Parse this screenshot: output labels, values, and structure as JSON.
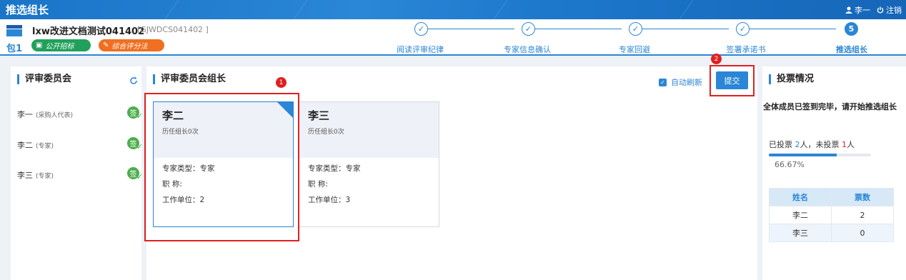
{
  "app": {
    "title": "推选组长"
  },
  "user": {
    "name": "李一",
    "logout_label": "注销"
  },
  "project": {
    "name": "lxw改进文档测试041402",
    "code": "[GJWDCS041402 ]",
    "package": "包1",
    "tags": [
      "公开招标",
      "综合评分法"
    ]
  },
  "steps": [
    {
      "label": "阅读评审纪律",
      "icon": "check",
      "number": ""
    },
    {
      "label": "专家信息确认",
      "icon": "check",
      "number": ""
    },
    {
      "label": "专家回避",
      "icon": "check",
      "number": ""
    },
    {
      "label": "签署承诺书",
      "icon": "check",
      "number": ""
    },
    {
      "label": "推选组长",
      "icon": "",
      "number": "5"
    }
  ],
  "committee": {
    "title": "评审委员会",
    "members": [
      {
        "name": "李一",
        "role": "(采购人代表)",
        "signed": "签"
      },
      {
        "name": "李二",
        "role": "(专家)",
        "signed": "签"
      },
      {
        "name": "李三",
        "role": "(专家)",
        "signed": "签"
      }
    ]
  },
  "leader": {
    "title": "评审委员会组长",
    "auto_refresh_label": "自动刷新",
    "submit_label": "提交",
    "candidates": [
      {
        "name": "李二",
        "history": "历任组长0次",
        "type_label": "专家类型：",
        "type": "专家",
        "title_label": "职 称:",
        "title": "",
        "unit_label": "工作单位：",
        "unit": "2"
      },
      {
        "name": "李三",
        "history": "历任组长0次",
        "type_label": "专家类型：",
        "type": "专家",
        "title_label": "职 称:",
        "title": "",
        "unit_label": "工作单位：",
        "unit": "3"
      }
    ]
  },
  "annotations": {
    "marker1": "1",
    "marker2": "2"
  },
  "vote": {
    "title": "投票情况",
    "message": "全体成员已签到完毕，请开始推选组长",
    "voted_prefix": "已投票 ",
    "voted_count": "2",
    "voted_mid": "人，未投票 ",
    "unvoted_count": "1",
    "unvoted_suffix": "人",
    "progress_fraction": 0.6667,
    "progress_text": "66.67%",
    "table_headers": [
      "姓名",
      "票数"
    ],
    "rows": [
      {
        "name": "李二",
        "votes": "2"
      },
      {
        "name": "李三",
        "votes": "0"
      }
    ]
  },
  "colors": {
    "primary": "#2a86d6",
    "green": "#21a05a",
    "orange": "#f06f21",
    "red": "#e02020"
  }
}
